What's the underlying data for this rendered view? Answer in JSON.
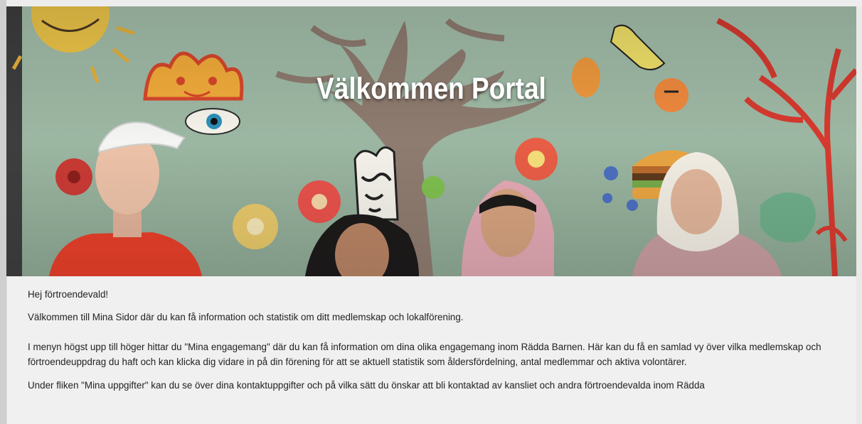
{
  "hero": {
    "title": "Välkommen Portal",
    "image": "children-and-mural-illustration"
  },
  "content": {
    "greeting": "Hej förtroendevald!",
    "intro": "Välkommen till Mina Sidor där du kan få information och statistik om ditt medlemskap och lokalförening.",
    "menu_info": "I menyn högst upp till höger hittar du \"Mina engagemang\" där du kan få information om dina olika engagemang inom Rädda Barnen. Här kan du få en samlad vy över vilka medlemskap och förtroendeuppdrag du haft och kan klicka dig vidare in på din förening för att se aktuell statistik som åldersfördelning, antal medlemmar och aktiva volontärer.",
    "details_info": "Under fliken \"Mina uppgifter\" kan du se över dina kontaktuppgifter och på vilka sätt du önskar att bli kontaktad av kansliet och andra förtroendevalda inom Rädda"
  },
  "colors": {
    "content_background": "#f0f0f0",
    "text": "#222222",
    "hero_title": "#ffffff"
  }
}
